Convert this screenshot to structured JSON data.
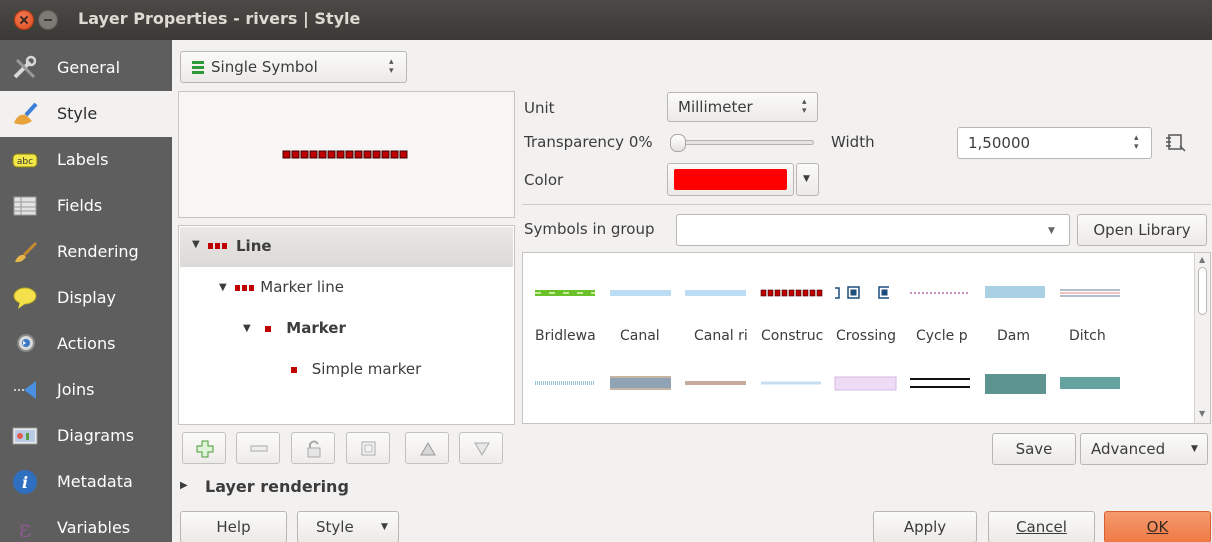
{
  "window": {
    "title": "Layer Properties - rivers | Style"
  },
  "sidebar": {
    "items": [
      {
        "label": "General",
        "icon": "tools-icon"
      },
      {
        "label": "Style",
        "icon": "paintbrush-icon",
        "selected": true
      },
      {
        "label": "Labels",
        "icon": "abc-label-icon"
      },
      {
        "label": "Fields",
        "icon": "table-icon"
      },
      {
        "label": "Rendering",
        "icon": "brush-icon"
      },
      {
        "label": "Display",
        "icon": "speech-bubble-icon"
      },
      {
        "label": "Actions",
        "icon": "gear-run-icon"
      },
      {
        "label": "Joins",
        "icon": "join-arrow-icon"
      },
      {
        "label": "Diagrams",
        "icon": "diagram-icon"
      },
      {
        "label": "Metadata",
        "icon": "info-icon"
      },
      {
        "label": "Variables",
        "icon": "epsilon-icon"
      }
    ]
  },
  "renderer": {
    "value": "Single Symbol"
  },
  "symbol_tree": {
    "root": "Line",
    "marker_line": "Marker line",
    "marker": "Marker",
    "simple_marker": "Simple marker"
  },
  "props": {
    "unit_label": "Unit",
    "unit_value": "Millimeter",
    "transparency_label": "Transparency 0%",
    "transparency_value": 0,
    "width_label": "Width",
    "width_value": "1,50000",
    "color_label": "Color",
    "color_value": "#ff0000"
  },
  "symbols": {
    "group_label": "Symbols in group",
    "group_value": "",
    "open_library": "Open Library",
    "row1": [
      "Bridlewa",
      "Canal",
      "Canal ri",
      "Construc",
      "Crossing",
      "Cycle p",
      "Dam",
      "Ditch"
    ],
    "save": "Save",
    "advanced": "Advanced"
  },
  "layer_rendering": "Layer rendering",
  "footer": {
    "help": "Help",
    "style": "Style",
    "apply": "Apply",
    "cancel": "Cancel",
    "ok": "OK"
  },
  "colors": {
    "accent": "#f07746",
    "sidebar": "#5e5e5e",
    "title_bar": "#3c3b37"
  }
}
